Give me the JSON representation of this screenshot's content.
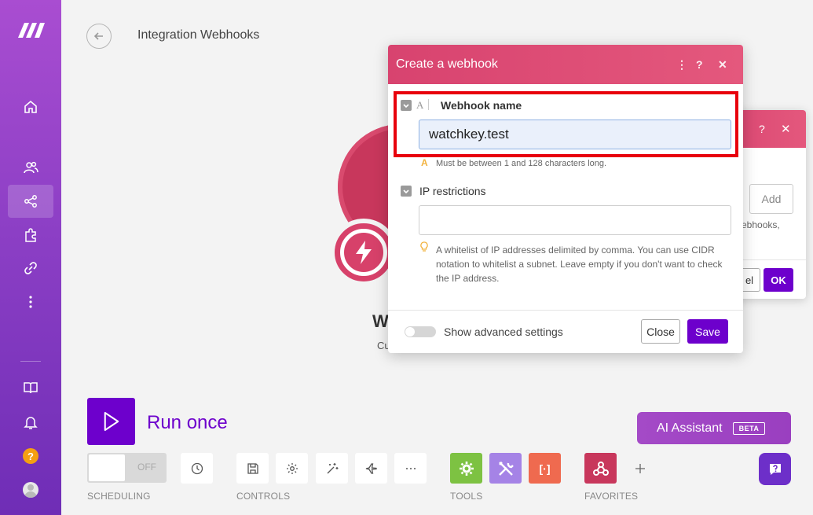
{
  "page": {
    "title": "Integration Webhooks"
  },
  "module": {
    "name": "W",
    "subtitle": "Cu"
  },
  "back_dialog": {
    "add_label": "Add",
    "text": "ebhooks,",
    "cancel_label": "el",
    "ok_label": "OK"
  },
  "dialog": {
    "title": "Create a webhook",
    "webhook_name": {
      "label": "Webhook name",
      "value": "watchkey.test",
      "type_icon": "A",
      "hint": "Must be between 1 and 128 characters long."
    },
    "ip_restrictions": {
      "label": "IP restrictions",
      "value": "",
      "help": "A whitelist of IP addresses delimited by comma. You can use CIDR notation to whitelist a subnet. Leave empty if you don't want to check the IP address."
    },
    "advanced_label": "Show advanced settings",
    "close_label": "Close",
    "save_label": "Save"
  },
  "bottom": {
    "run_label": "Run once",
    "ai_label": "AI Assistant",
    "ai_badge": "BETA",
    "scheduling_state": "OFF",
    "sections": {
      "scheduling": "SCHEDULING",
      "controls": "CONTROLS",
      "tools": "TOOLS",
      "favorites": "FAVORITES"
    }
  },
  "colors": {
    "sidebar": "#8c3fc5",
    "dialog_header": "#d8436f",
    "primary": "#6d00cc",
    "highlight": "#e8000c"
  },
  "icons": {
    "sidebar": [
      "logo-icon",
      "home-icon",
      "users-icon",
      "share-icon",
      "puzzle-icon",
      "link-icon",
      "more-vertical-icon",
      "book-icon",
      "bell-icon",
      "help-icon",
      "avatar-icon"
    ]
  }
}
